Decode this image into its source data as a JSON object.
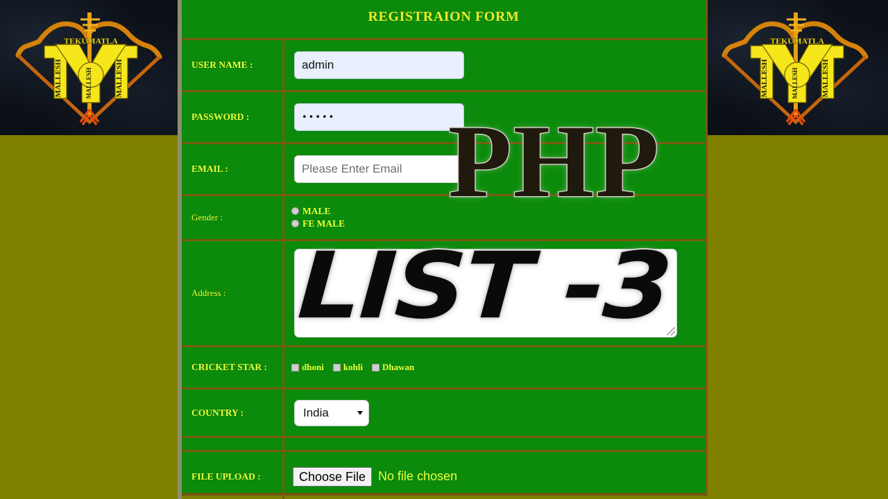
{
  "page": {
    "background_color": "#808000",
    "form_background_color": "#0b8a0b",
    "border_color": "#7a5a12",
    "label_color": "#eaff3c",
    "title_color": "#ece82b"
  },
  "branding": {
    "logo_top_text": "TEKUMATLA",
    "logo_name_left": "MALLESH",
    "logo_name_right": "MALLESH",
    "logo_name_center": "MALLESH",
    "logo_letter_left": "M",
    "logo_letter_right": "M"
  },
  "watermarks": {
    "php": "PHP",
    "list": "LIST -3"
  },
  "form": {
    "title": "REGISTRAION FORM",
    "rows": [
      {
        "label": "USER NAME :",
        "value": "admin"
      },
      {
        "label": "PASSWORD :",
        "value": "•••••"
      },
      {
        "label": "EMAIL :",
        "placeholder": "Please Enter Email",
        "value": ""
      },
      {
        "label": "Gender :"
      },
      {
        "label": "Address :",
        "value": ""
      },
      {
        "label": "CRICKET STAR :"
      },
      {
        "label": "COUNTRY :"
      },
      {
        "label": "FILE UPLOAD :"
      }
    ],
    "gender": {
      "options": [
        {
          "label": "MALE",
          "checked": false
        },
        {
          "label": "FE MALE",
          "checked": false
        }
      ]
    },
    "cricket_star": {
      "options": [
        {
          "label": "dhoni",
          "checked": false
        },
        {
          "label": "kohli",
          "checked": false
        },
        {
          "label": "Dhawan",
          "checked": false
        }
      ]
    },
    "country": {
      "selected": "India"
    },
    "file_upload": {
      "button_label": "Choose File",
      "status": "No file chosen"
    }
  }
}
